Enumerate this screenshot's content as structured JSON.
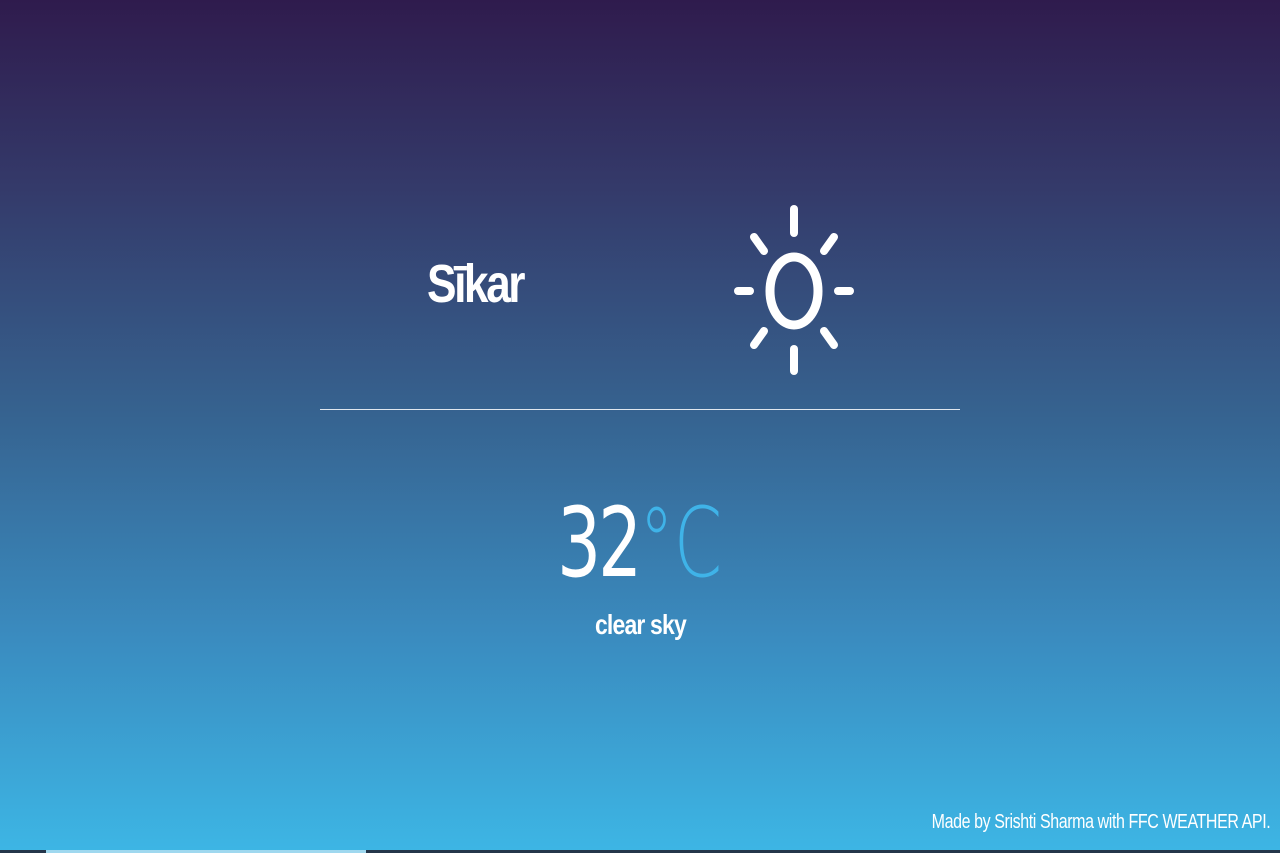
{
  "weather": {
    "city": "Sīkar",
    "temperature": "32",
    "unit": "°C",
    "description": "clear sky",
    "icon": "sun-icon"
  },
  "footer": {
    "credit": "Made by Srishti Sharma with FFC WEATHER API."
  },
  "colors": {
    "unit_accent": "#3fb3e8",
    "gradient_top": "#2f1b4d",
    "gradient_bottom": "#3db6e5"
  }
}
